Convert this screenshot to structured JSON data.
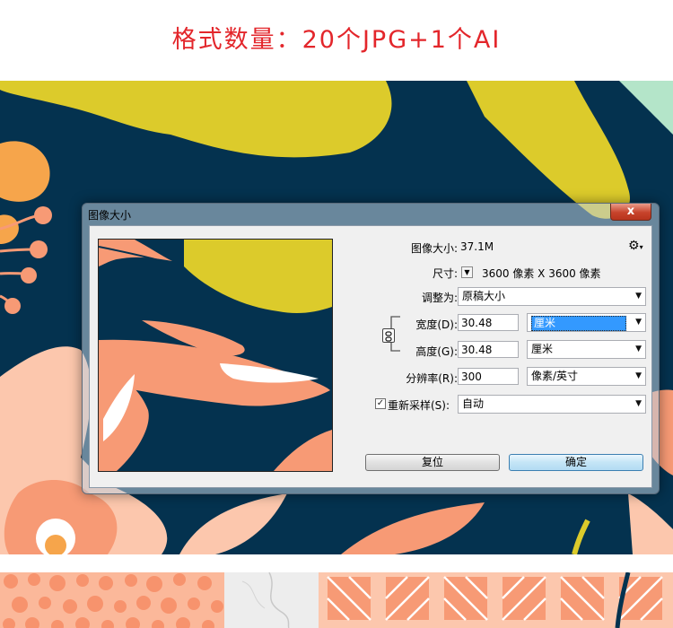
{
  "headline": "格式数量：20个JPG+1个AI",
  "colors": {
    "navy": "#04324f",
    "mustard": "#dccb2b",
    "salmon": "#f79a75",
    "peach": "#fcc7ad",
    "orange": "#f6a54b",
    "mint": "#b4e5c9",
    "headline_red": "#e3262b"
  },
  "dialog": {
    "title": "图像大小",
    "close_label": "x",
    "image_size_label": "图像大小:",
    "image_size_value": "37.1M",
    "gear_icon": "gear-icon",
    "dimensions_label": "尺寸:",
    "dimensions_value": "3600 像素  X  3600 像素",
    "fit_label": "调整为:",
    "fit_value": "原稿大小",
    "width_label": "宽度(D):",
    "width_value": "30.48",
    "width_unit": "厘米",
    "height_label": "高度(G):",
    "height_value": "30.48",
    "height_unit": "厘米",
    "resolution_label": "分辨率(R):",
    "resolution_value": "300",
    "resolution_unit": "像素/英寸",
    "resample_label": "重新采样(S):",
    "resample_checked": true,
    "resample_value": "自动",
    "reset_button": "复位",
    "ok_button": "确定"
  }
}
